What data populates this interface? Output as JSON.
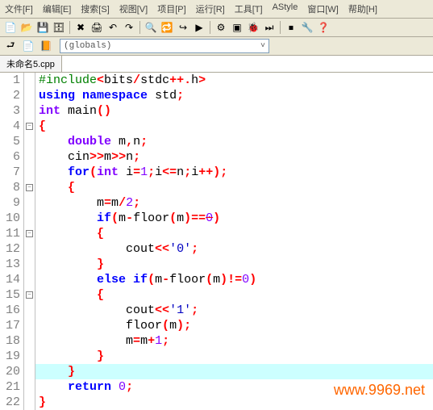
{
  "menubar": {
    "items": [
      "文件[F]",
      "编辑[E]",
      "搜索[S]",
      "视图[V]",
      "项目[P]",
      "运行[R]",
      "工具[T]",
      "AStyle",
      "窗口[W]",
      "帮助[H]"
    ]
  },
  "toolbar1": {
    "icons": [
      "new",
      "open",
      "save",
      "saveall",
      "close",
      "print",
      "undo",
      "redo",
      "find",
      "replace",
      "goto",
      "run",
      "compile",
      "compilerun",
      "debug",
      "step",
      "stop",
      "config",
      "help"
    ]
  },
  "toolbar2": {
    "back_icon": "back",
    "fwd_icon": "forward",
    "bookmark_icon": "bookmark",
    "globals_label": "(globals)"
  },
  "tab": {
    "title": "未命名5.cpp"
  },
  "code": {
    "lines": [
      {
        "n": "1",
        "fold": "",
        "html": "<span class='pp'>#include</span><span class='op'>&lt;</span><span class='id'>bits</span><span class='op'>/</span><span class='id'>stdc</span><span class='op'>++.</span><span class='id'>h</span><span class='op'>&gt;</span>"
      },
      {
        "n": "2",
        "fold": "",
        "html": "<span class='kw'>using</span> <span class='kw'>namespace</span> <span class='id'>std</span><span class='op'>;</span>"
      },
      {
        "n": "3",
        "fold": "",
        "html": "<span class='type'>int</span> <span class='fn'>main</span><span class='op'>()</span>"
      },
      {
        "n": "4",
        "fold": "-",
        "html": "<span class='op'>{</span>"
      },
      {
        "n": "5",
        "fold": "",
        "html": "    <span class='type'>double</span> <span class='id'>m</span><span class='op'>,</span><span class='id'>n</span><span class='op'>;</span>"
      },
      {
        "n": "6",
        "fold": "",
        "html": "    <span class='id'>cin</span><span class='op'>&gt;&gt;</span><span class='id'>m</span><span class='op'>&gt;&gt;</span><span class='id'>n</span><span class='op'>;</span>"
      },
      {
        "n": "7",
        "fold": "",
        "html": "    <span class='kw'>for</span><span class='op'>(</span><span class='type'>int</span> <span class='id'>i</span><span class='op'>=</span><span class='num-lit'>1</span><span class='op'>;</span><span class='id'>i</span><span class='op'>&lt;=</span><span class='id'>n</span><span class='op'>;</span><span class='id'>i</span><span class='op'>++);</span>"
      },
      {
        "n": "8",
        "fold": "-",
        "html": "    <span class='op'>{</span>"
      },
      {
        "n": "9",
        "fold": "",
        "html": "        <span class='id'>m</span><span class='op'>=</span><span class='id'>m</span><span class='op'>/</span><span class='num-lit'>2</span><span class='op'>;</span>"
      },
      {
        "n": "10",
        "fold": "",
        "html": "        <span class='kw'>if</span><span class='op'>(</span><span class='id'>m</span><span class='op'>-</span><span class='fn'>floor</span><span class='op'>(</span><span class='id'>m</span><span class='op'>)==</span><span class='num-lit strike'>0</span><span class='op'>)</span>"
      },
      {
        "n": "11",
        "fold": "-",
        "html": "        <span class='op'>{</span>"
      },
      {
        "n": "12",
        "fold": "",
        "html": "            <span class='id'>cout</span><span class='op'>&lt;&lt;</span><span class='char-lit'>'0'</span><span class='op'>;</span>"
      },
      {
        "n": "13",
        "fold": "",
        "html": "        <span class='op'>}</span>"
      },
      {
        "n": "14",
        "fold": "",
        "html": "        <span class='kw'>else</span> <span class='kw'>if</span><span class='op'>(</span><span class='id'>m</span><span class='op'>-</span><span class='fn'>floor</span><span class='op'>(</span><span class='id'>m</span><span class='op'>)!=</span><span class='num-lit'>0</span><span class='op'>)</span>"
      },
      {
        "n": "15",
        "fold": "-",
        "html": "        <span class='op'>{</span>"
      },
      {
        "n": "16",
        "fold": "",
        "html": "            <span class='id'>cout</span><span class='op'>&lt;&lt;</span><span class='char-lit'>'1'</span><span class='op'>;</span>"
      },
      {
        "n": "17",
        "fold": "",
        "html": "            <span class='fn'>floor</span><span class='op'>(</span><span class='id'>m</span><span class='op'>);</span>"
      },
      {
        "n": "18",
        "fold": "",
        "html": "            <span class='id'>m</span><span class='op'>=</span><span class='id'>m</span><span class='op'>+</span><span class='num-lit'>1</span><span class='op'>;</span>"
      },
      {
        "n": "19",
        "fold": "",
        "html": "        <span class='op'>}</span>"
      },
      {
        "n": "20",
        "fold": "",
        "html": "    <span class='op'>}</span>",
        "highlighted": true
      },
      {
        "n": "21",
        "fold": "",
        "html": "    <span class='kw'>return</span> <span class='num-lit'>0</span><span class='op'>;</span>"
      },
      {
        "n": "22",
        "fold": "",
        "html": "<span class='op'>}</span>"
      }
    ]
  },
  "watermark": "www.9969.net"
}
